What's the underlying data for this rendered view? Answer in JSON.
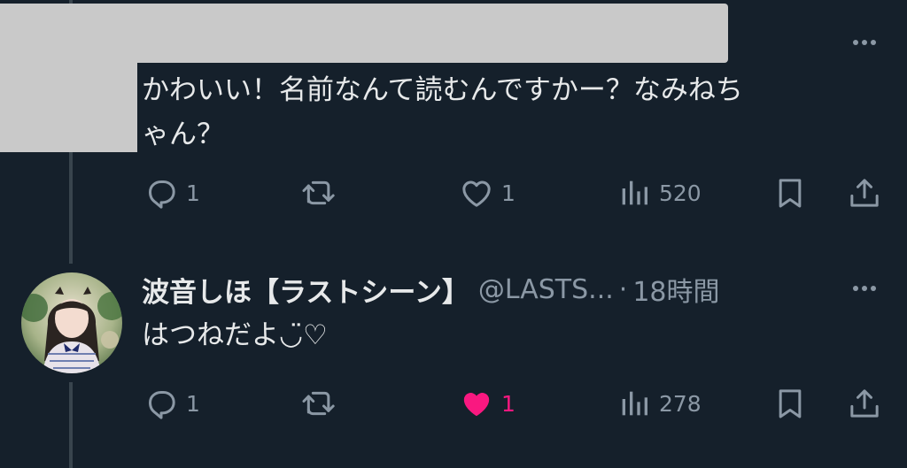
{
  "tweet1": {
    "text_line1": "かわいい！名前なんて読むんですかー？なみねち",
    "text_line2": "ゃん？",
    "replies": "1",
    "likes": "1",
    "views": "520"
  },
  "tweet2": {
    "display_name": "波音しほ【ラストシーン】",
    "handle": "@LASTS...",
    "separator": "·",
    "time": "18時間",
    "text": "はつねだよ◡̈♡",
    "replies": "1",
    "likes": "1",
    "liked": true,
    "views": "278"
  },
  "colors": {
    "background": "#15202b",
    "text": "#e7e9ea",
    "muted": "#8b98a5",
    "like_active": "#f91880",
    "thread_line": "#38444d"
  },
  "icons": [
    "more-icon",
    "reply-icon",
    "retweet-icon",
    "like-icon",
    "views-icon",
    "bookmark-icon",
    "share-icon"
  ]
}
